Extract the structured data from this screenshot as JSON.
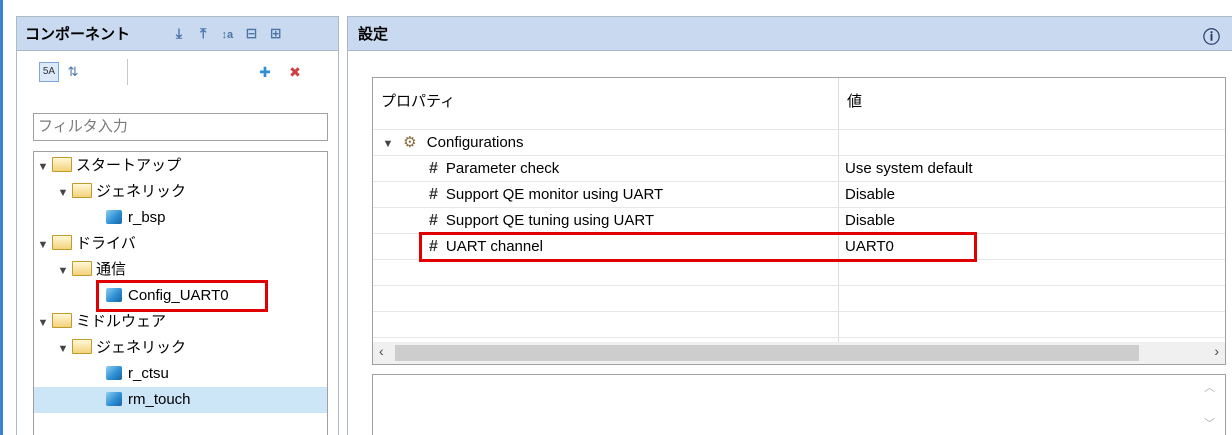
{
  "left_panel": {
    "title": "コンポーネント",
    "filter": {
      "placeholder": "フィルタ入力",
      "value": ""
    },
    "tree": [
      {
        "label": "スタートアップ",
        "type": "folder",
        "depth": 0
      },
      {
        "label": "ジェネリック",
        "type": "folder",
        "depth": 1
      },
      {
        "label": "r_bsp",
        "type": "component",
        "depth": 2
      },
      {
        "label": "ドライバ",
        "type": "folder",
        "depth": 0
      },
      {
        "label": "通信",
        "type": "folder",
        "depth": 1
      },
      {
        "label": "Config_UART0",
        "type": "component",
        "depth": 2,
        "highlighted": true
      },
      {
        "label": "ミドルウェア",
        "type": "folder",
        "depth": 0
      },
      {
        "label": "ジェネリック",
        "type": "folder",
        "depth": 1
      },
      {
        "label": "r_ctsu",
        "type": "component",
        "depth": 2
      },
      {
        "label": "rm_touch",
        "type": "component",
        "depth": 2,
        "selected": true
      }
    ]
  },
  "right_panel": {
    "title": "設定",
    "info_icon": "ⓘ",
    "columns": {
      "property": "プロパティ",
      "value": "値"
    },
    "group": "Configurations",
    "properties": [
      {
        "name": "Parameter check",
        "value": "Use system default"
      },
      {
        "name": "Support QE monitor using UART",
        "value": "Disable"
      },
      {
        "name": "Support QE tuning using UART",
        "value": "Disable"
      },
      {
        "name": "UART channel",
        "value": "UART0",
        "highlighted": true
      }
    ]
  },
  "colors": {
    "header_bg": "#c9daf0",
    "selection": "#cde6f7",
    "highlight_border": "#e00000",
    "accent": "#3d7fd1"
  }
}
